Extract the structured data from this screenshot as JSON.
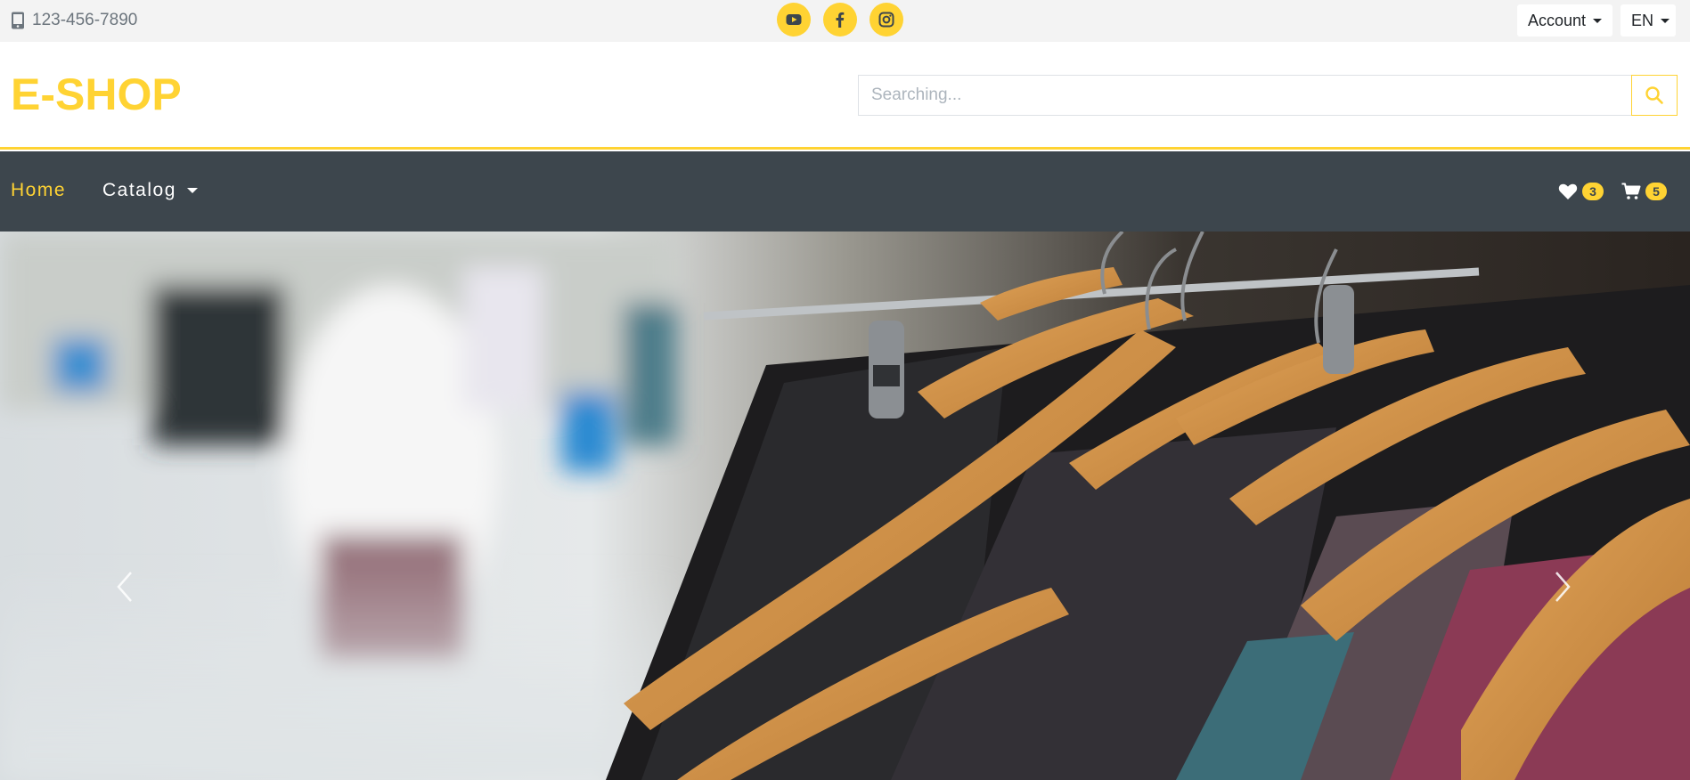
{
  "topbar": {
    "phone": "123-456-7890",
    "socials": [
      {
        "icon": "youtube-icon"
      },
      {
        "icon": "facebook-icon"
      },
      {
        "icon": "instagram-icon"
      }
    ],
    "account_label": "Account",
    "language_label": "EN"
  },
  "header": {
    "logo": "E-SHOP",
    "search_placeholder": "Searching..."
  },
  "nav": {
    "home_label": "Home",
    "catalog_label": "Catalog",
    "wishlist_count": "3",
    "cart_count": "5"
  },
  "carousel": {
    "image": "clothes-rack-photo"
  },
  "colors": {
    "accent": "#ffd333",
    "nav_bg": "#3d464d",
    "topbar_bg": "#f3f3f3"
  }
}
